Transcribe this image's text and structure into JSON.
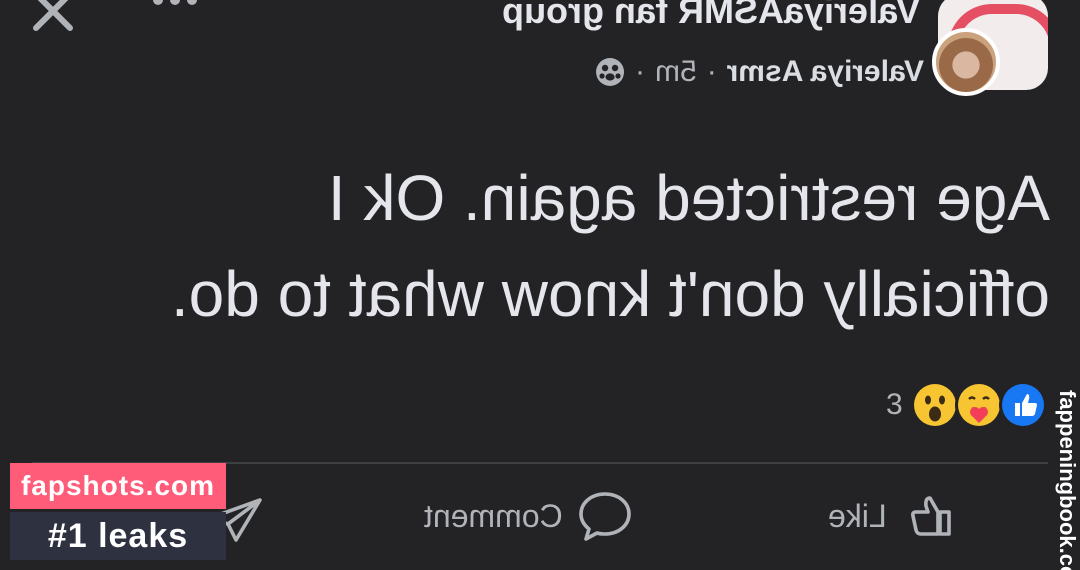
{
  "header": {
    "group_name": "ValeriyaASMR fan group",
    "author_name": "Valeriya Asmr",
    "time_ago": "5m",
    "separator": "·",
    "privacy_icon": "group-privacy-icon",
    "close_icon": "close-icon",
    "more_icon": "more-options-icon"
  },
  "post": {
    "text": "Age restricted again. Ok I officially don't know what to do."
  },
  "reactions": {
    "count": "3",
    "types": [
      "like-reaction-icon",
      "care-reaction-icon",
      "wow-reaction-icon"
    ]
  },
  "actions": {
    "like_label": "Like",
    "comment_label": "Comment",
    "share_icon": "share-icon"
  },
  "watermark": {
    "line1": "fapshots.com",
    "line2": "#1 leaks",
    "side": "fappeningbook.co"
  },
  "colors": {
    "background": "#232326",
    "text": "#e4e6eb",
    "muted": "#b0b3b8",
    "like_blue": "#1877f2",
    "watermark_pink": "#ff5c7a",
    "watermark_dark": "#2e3140"
  }
}
